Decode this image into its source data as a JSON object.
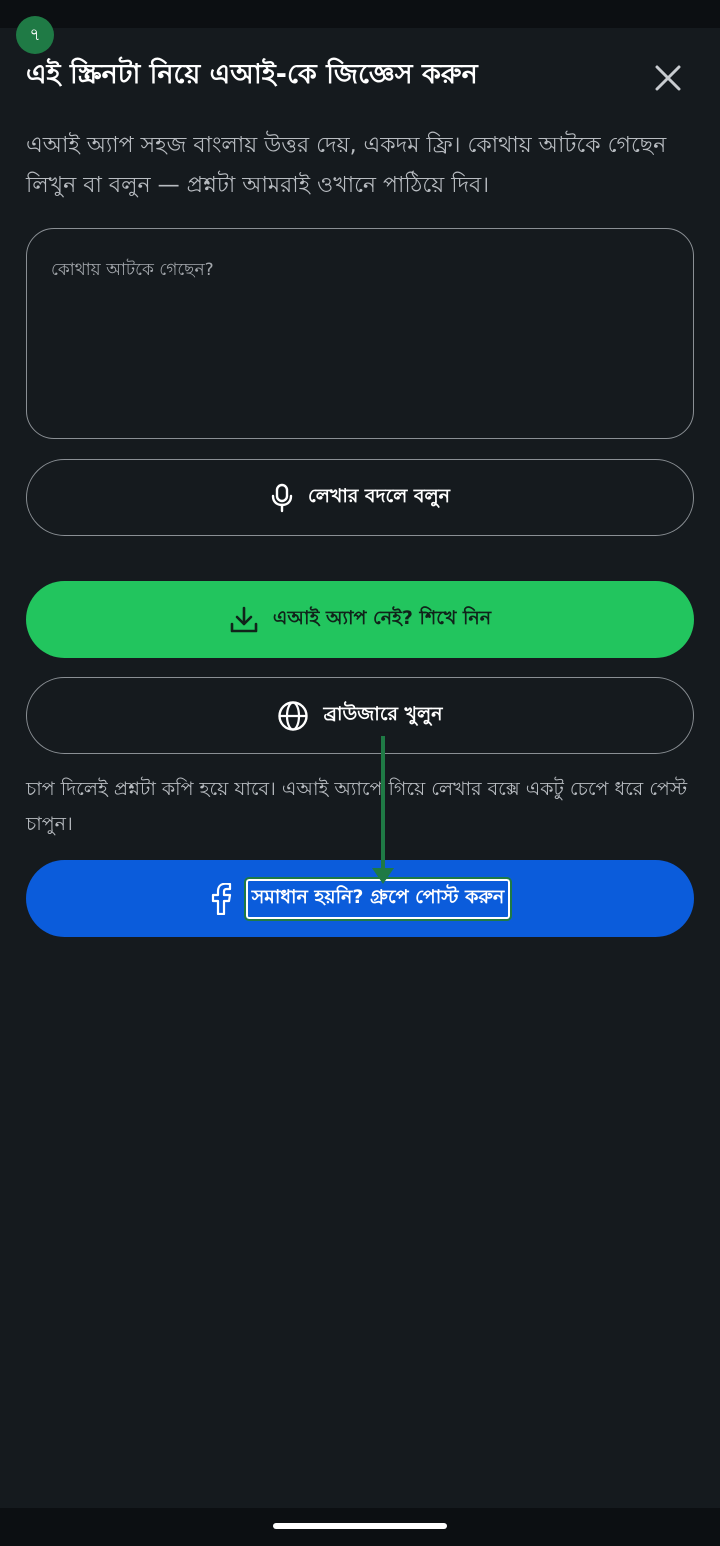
{
  "step_badge": "৭",
  "title": "এই স্ক্রিনটা নিয়ে এআই-কে জিজ্ঞেস করুন",
  "description": "এআই অ্যাপ সহজ বাংলায় উত্তর দেয়, একদম ফ্রি। কোথায় আটকে গেছেন লিখুন বা বলুন — প্রশ্নটা আমরাই ওখানে পাঠিয়ে দিব।",
  "question_input": {
    "placeholder": "কোথায় আটকে গেছেন?",
    "value": ""
  },
  "buttons": {
    "voice": "লেখার বদলে বলুন",
    "learn_app": "এআই অ্যাপ নেই? শিখে নিন",
    "open_browser": "ব্রাউজারে খুলুন",
    "post_group": "সমাধান হয়নি? গ্রুপে পোস্ট করুন"
  },
  "hint": "চাপ দিলেই প্রশ্নটা কপি হয়ে যাবে। এআই অ্যাপে গিয়ে লেখার বক্সে একটু চেপে ধরে পেস্ট চাপুন।",
  "icons": {
    "close": "close-icon",
    "voice": "microphone-icon",
    "learn_app": "download-icon",
    "open_browser": "globe-icon",
    "post_group": "facebook-icon"
  },
  "colors": {
    "background": "#151a1e",
    "accent_green": "#22c55e",
    "accent_blue": "#0b5cdb",
    "badge_green": "#1f7a45"
  }
}
